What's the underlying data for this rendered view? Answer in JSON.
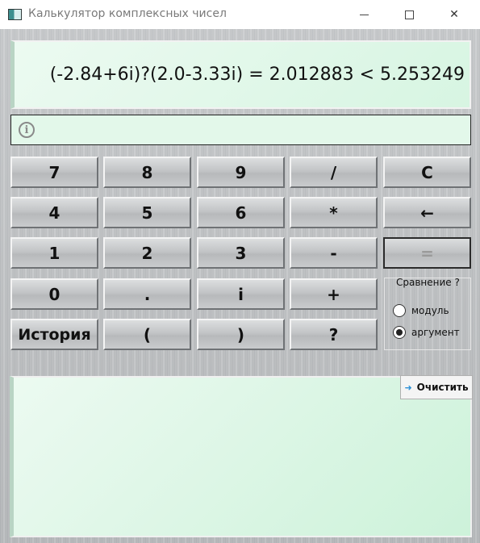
{
  "window": {
    "title": "Калькулятор комплексных чисел",
    "minimize_label": "",
    "maximize_label": "",
    "close_label": "✕"
  },
  "display": {
    "expression": "(-2.84+6i)?(2.0-3.33i) = 2.012883 < 5.253249"
  },
  "info": {
    "icon": "i",
    "text": ""
  },
  "keypad": {
    "row1": [
      "7",
      "8",
      "9",
      "/",
      "C"
    ],
    "row2": [
      "4",
      "5",
      "6",
      "*",
      "←"
    ],
    "row3": [
      "1",
      "2",
      "3",
      "-",
      "="
    ],
    "row4": [
      "0",
      ".",
      "i",
      "+"
    ],
    "row5": [
      "История",
      "(",
      ")",
      "?"
    ]
  },
  "compare": {
    "title": "Сравнение ?",
    "options": [
      "модуль",
      "аргумент"
    ],
    "selected": "аргумент"
  },
  "history": {
    "clear_label": "Очистить",
    "entries": []
  }
}
